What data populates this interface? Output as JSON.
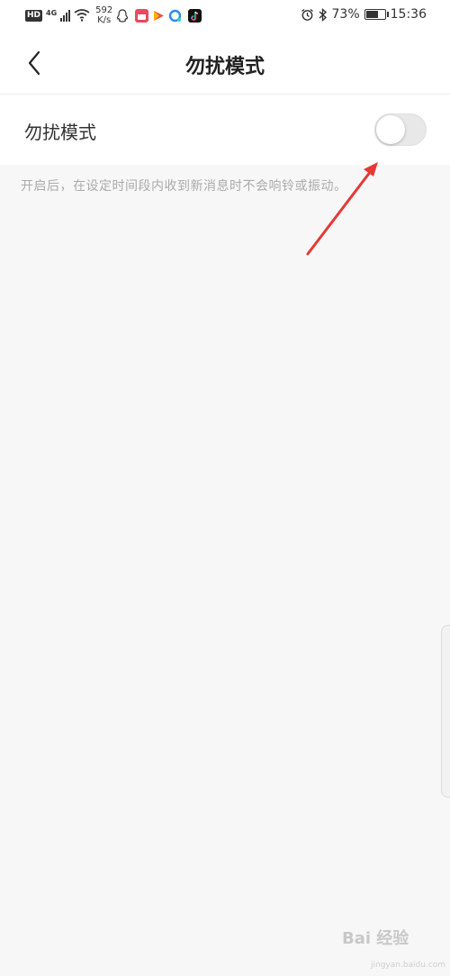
{
  "status_bar": {
    "hd": "HD",
    "network_gen": "4G",
    "speed_value": "592",
    "speed_unit": "K/s",
    "battery_percent": "73%",
    "battery_level": 0.73,
    "time": "15:36",
    "icons": [
      "signal-icon",
      "wifi-icon",
      "qq-icon",
      "calendar-app-icon",
      "video-app-icon",
      "browser-app-icon",
      "tiktok-icon",
      "alarm-icon",
      "bluetooth-icon",
      "battery-icon"
    ]
  },
  "nav": {
    "title": "勿扰模式",
    "back_icon": "chevron-left-icon"
  },
  "setting": {
    "label": "勿扰模式",
    "toggle_on": false,
    "description": "开启后，在设定时间段内收到新消息时不会响铃或振动。"
  },
  "colors": {
    "arrow": "#e53935",
    "background": "#f7f7f7"
  },
  "watermark": {
    "brand": "Bai 经验",
    "domain": "jingyan.baidu.com"
  }
}
